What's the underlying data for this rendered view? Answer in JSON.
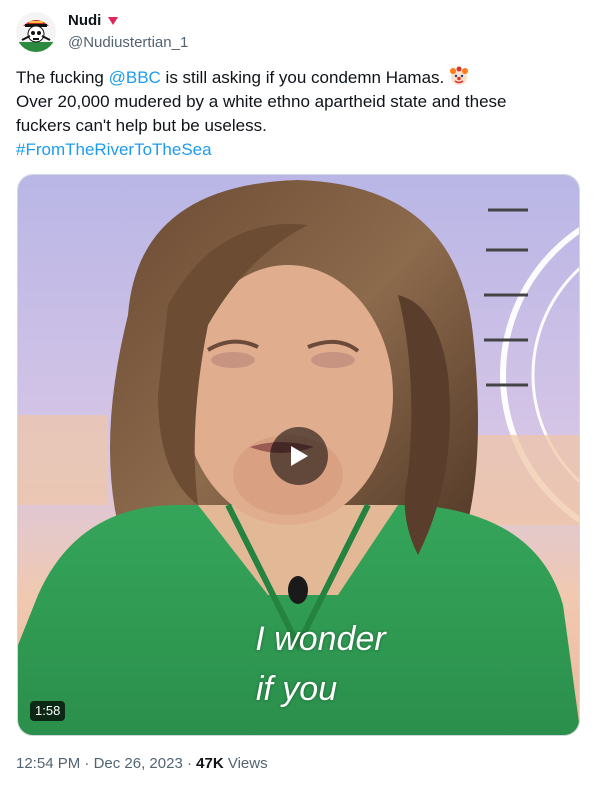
{
  "author": {
    "display_name": "Nudi",
    "handle": "@Nudiustertian_1",
    "avatar_icon": "pirate-skull-icon",
    "badge_icon": "pink-heart-icon",
    "badge_color": "#e0245e"
  },
  "tweet": {
    "text_part1": "The fucking ",
    "mention": "@BBC",
    "text_part2": " is still asking if you condemn Hamas. ",
    "emoji_icon": "clown-face-icon",
    "line2": "Over 20,000 mudered by a white ethno apartheid state and these",
    "line3": "fuckers can't help but be useless.",
    "hashtag": "#FromTheRiverToTheSea",
    "link_color": "#1d9bf0"
  },
  "media": {
    "type": "video",
    "subtitle_line1": "I wonder",
    "subtitle_line2": "if you",
    "duration": "1:58",
    "play_icon": "play-icon"
  },
  "meta": {
    "time": "12:54 PM",
    "separator": " · ",
    "date": "Dec 26, 2023",
    "views_count": "47K",
    "views_label": " Views"
  }
}
